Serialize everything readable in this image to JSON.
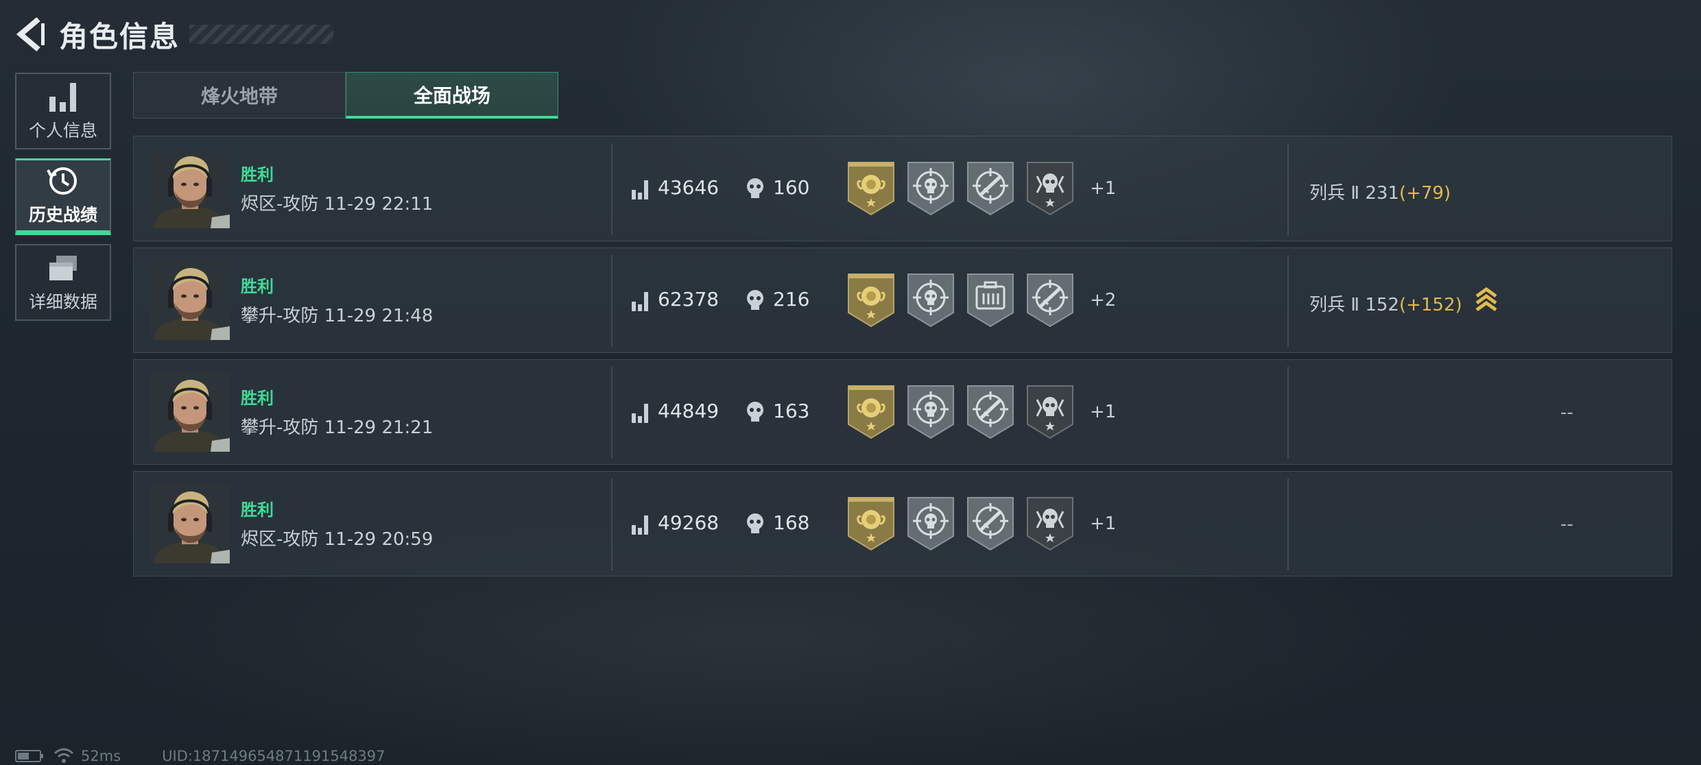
{
  "header": {
    "title": "角色信息"
  },
  "sidebar": {
    "items": [
      {
        "label": "个人信息",
        "icon": "bar-chart-icon"
      },
      {
        "label": "历史战绩",
        "icon": "history-clock-icon",
        "active": true
      },
      {
        "label": "详细数据",
        "icon": "cards-icon"
      }
    ]
  },
  "tabs": [
    {
      "label": "烽火地带"
    },
    {
      "label": "全面战场",
      "active": true
    }
  ],
  "matches": [
    {
      "result": "胜利",
      "mode": "烬区-攻防 11-29 22:11",
      "score": "43646",
      "kills": "160",
      "badges": [
        "gold-rose-badge",
        "crosshair-skull-badge",
        "crosshair-rifle-badge",
        "dark-skull-badge"
      ],
      "more": "+1",
      "rank": "列兵 Ⅱ 231",
      "rank_gain": "(+79)",
      "rank_up": false
    },
    {
      "result": "胜利",
      "mode": "攀升-攻防 11-29 21:48",
      "score": "62378",
      "kills": "216",
      "badges": [
        "gold-rose-badge",
        "crosshair-skull-badge",
        "supply-box-badge",
        "crosshair-rifle-badge"
      ],
      "more": "+2",
      "rank": "列兵 Ⅱ 152",
      "rank_gain": "(+152)",
      "rank_up": true
    },
    {
      "result": "胜利",
      "mode": "攀升-攻防 11-29 21:21",
      "score": "44849",
      "kills": "163",
      "badges": [
        "gold-rose-badge",
        "crosshair-skull-badge",
        "crosshair-rifle-badge",
        "dark-skull-badge"
      ],
      "more": "+1",
      "rank_empty": "--"
    },
    {
      "result": "胜利",
      "mode": "烬区-攻防 11-29 20:59",
      "score": "49268",
      "kills": "168",
      "badges": [
        "gold-rose-badge",
        "crosshair-skull-badge",
        "crosshair-rifle-badge",
        "dark-skull-badge"
      ],
      "more": "+1",
      "rank_empty": "--"
    }
  ],
  "footer": {
    "latency": "52ms",
    "uid": "UID:1871496548711915483​97"
  },
  "colors": {
    "accent": "#3ddc97",
    "gain": "#e2b94c",
    "badge_gold": "#8a7a45",
    "badge_silver": "#6b7478"
  }
}
